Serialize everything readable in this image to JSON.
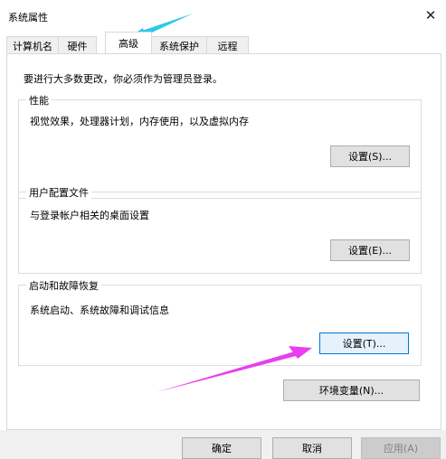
{
  "window": {
    "title": "系统属性",
    "close_icon": "close-icon"
  },
  "tabs": [
    {
      "label": "计算机名",
      "active": false
    },
    {
      "label": "硬件",
      "active": false
    },
    {
      "label": "高级",
      "active": true
    },
    {
      "label": "系统保护",
      "active": false
    },
    {
      "label": "远程",
      "active": false
    }
  ],
  "panel": {
    "admin_note": "要进行大多数更改，你必须作为管理员登录。",
    "performance": {
      "title": "性能",
      "description": "视觉效果，处理器计划，内存使用，以及虚拟内存",
      "button": "设置(S)..."
    },
    "user_profiles": {
      "title": "用户配置文件",
      "description": "与登录帐户相关的桌面设置",
      "button": "设置(E)..."
    },
    "startup_recovery": {
      "title": "启动和故障恢复",
      "description": "系统启动、系统故障和调试信息",
      "button": "设置(T)..."
    },
    "env_button": "环境变量(N)..."
  },
  "footer": {
    "ok": "确定",
    "cancel": "取消",
    "apply": "应用(A)"
  },
  "annotations": {
    "tab_arrow_color": "#2ec8e6",
    "button_arrow_color": "#e83ef0"
  }
}
